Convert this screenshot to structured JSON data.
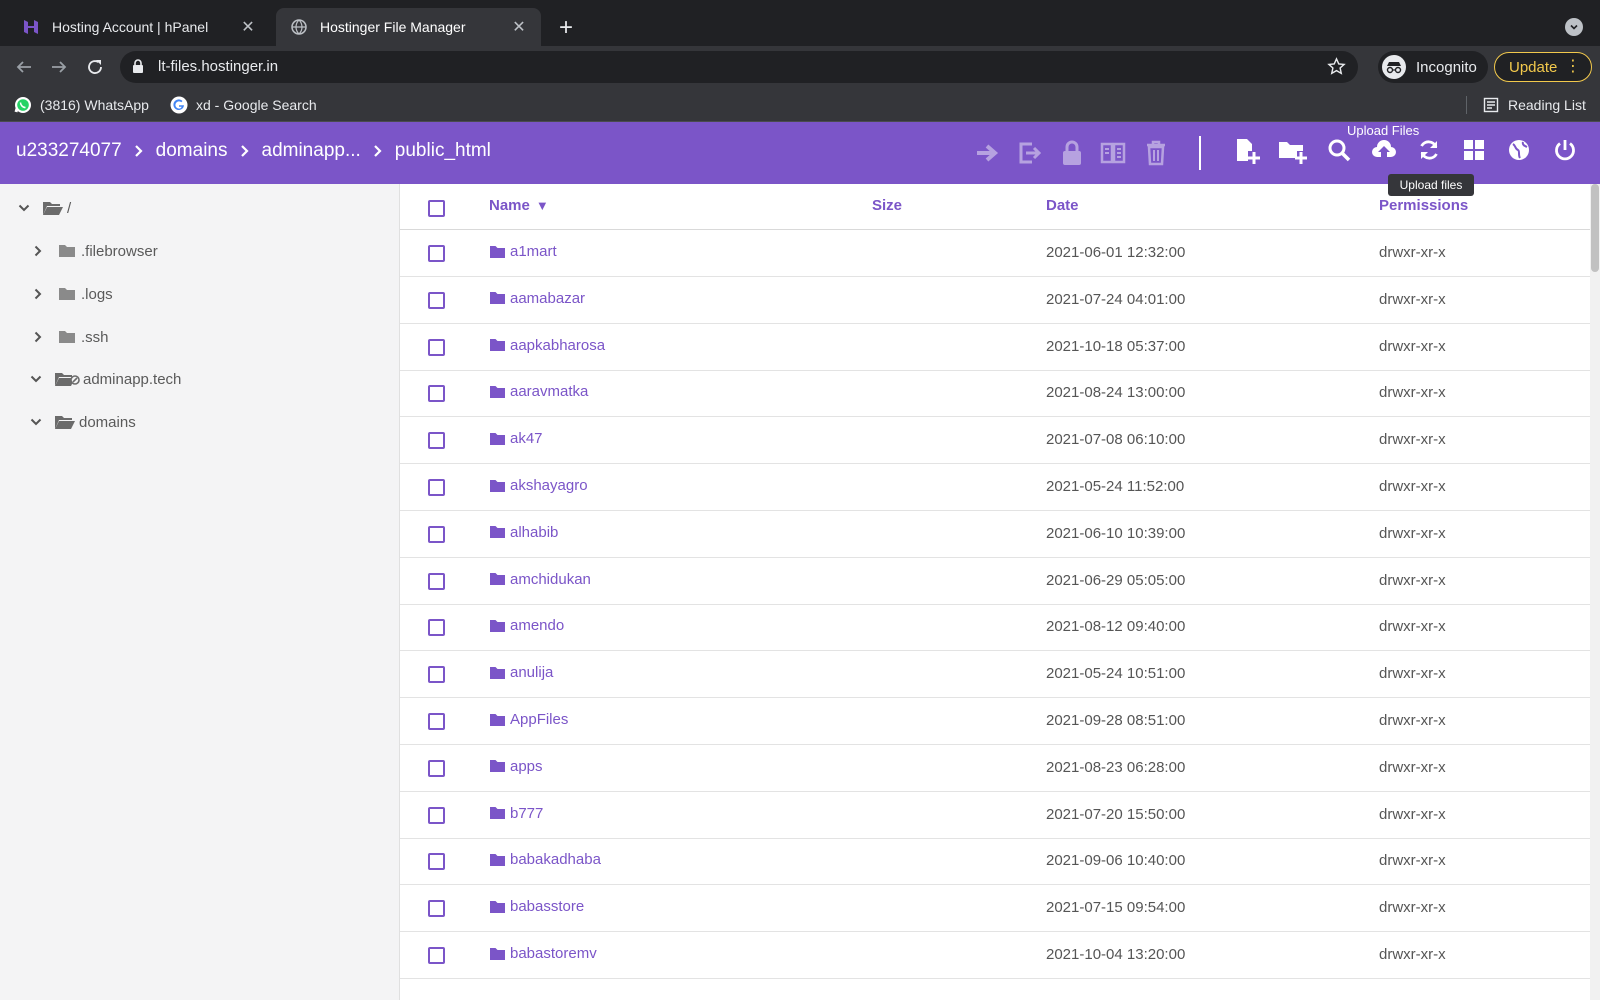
{
  "browser": {
    "tabs": [
      {
        "title": "Hosting Account | hPanel",
        "active": false
      },
      {
        "title": "Hostinger File Manager",
        "active": true
      }
    ],
    "url": "lt-files.hostinger.in",
    "incognito_label": "Incognito",
    "update_label": "Update",
    "bookmarks": [
      {
        "label": "(3816) WhatsApp",
        "icon": "whatsapp-icon"
      },
      {
        "label": "xd - Google Search",
        "icon": "google-icon"
      }
    ],
    "reading_list": "Reading List"
  },
  "header": {
    "breadcrumbs": [
      "u233274077",
      "domains",
      "adminapp...",
      "public_html"
    ],
    "upload_files_label": "Upload Files",
    "tooltip": "Upload files"
  },
  "colors": {
    "brand": "#7b55c8",
    "browser_dark": "#202124",
    "browser_toolbar": "#35363a"
  },
  "sidebar": {
    "root": "/",
    "items": [
      {
        "label": ".filebrowser",
        "expanded": false
      },
      {
        "label": ".logs",
        "expanded": false
      },
      {
        "label": ".ssh",
        "expanded": false
      },
      {
        "label": "adminapp.tech",
        "expanded": true
      },
      {
        "label": "domains",
        "expanded": true
      }
    ]
  },
  "table": {
    "columns": {
      "name": "Name",
      "size": "Size",
      "date": "Date",
      "permissions": "Permissions"
    },
    "sort_indicator": "▼",
    "rows": [
      {
        "name": "a1mart",
        "date": "2021-06-01 12:32:00",
        "perm": "drwxr-xr-x"
      },
      {
        "name": "aamabazar",
        "date": "2021-07-24 04:01:00",
        "perm": "drwxr-xr-x"
      },
      {
        "name": "aapkabharosa",
        "date": "2021-10-18 05:37:00",
        "perm": "drwxr-xr-x"
      },
      {
        "name": "aaravmatka",
        "date": "2021-08-24 13:00:00",
        "perm": "drwxr-xr-x"
      },
      {
        "name": "ak47",
        "date": "2021-07-08 06:10:00",
        "perm": "drwxr-xr-x"
      },
      {
        "name": "akshayagro",
        "date": "2021-05-24 11:52:00",
        "perm": "drwxr-xr-x"
      },
      {
        "name": "alhabib",
        "date": "2021-06-10 10:39:00",
        "perm": "drwxr-xr-x"
      },
      {
        "name": "amchidukan",
        "date": "2021-06-29 05:05:00",
        "perm": "drwxr-xr-x"
      },
      {
        "name": "amendo",
        "date": "2021-08-12 09:40:00",
        "perm": "drwxr-xr-x"
      },
      {
        "name": "anulija",
        "date": "2021-05-24 10:51:00",
        "perm": "drwxr-xr-x"
      },
      {
        "name": "AppFiles",
        "date": "2021-09-28 08:51:00",
        "perm": "drwxr-xr-x"
      },
      {
        "name": "apps",
        "date": "2021-08-23 06:28:00",
        "perm": "drwxr-xr-x"
      },
      {
        "name": "b777",
        "date": "2021-07-20 15:50:00",
        "perm": "drwxr-xr-x"
      },
      {
        "name": "babakadhaba",
        "date": "2021-09-06 10:40:00",
        "perm": "drwxr-xr-x"
      },
      {
        "name": "babasstore",
        "date": "2021-07-15 09:54:00",
        "perm": "drwxr-xr-x"
      },
      {
        "name": "babastoremv",
        "date": "2021-10-04 13:20:00",
        "perm": "drwxr-xr-x"
      }
    ]
  }
}
